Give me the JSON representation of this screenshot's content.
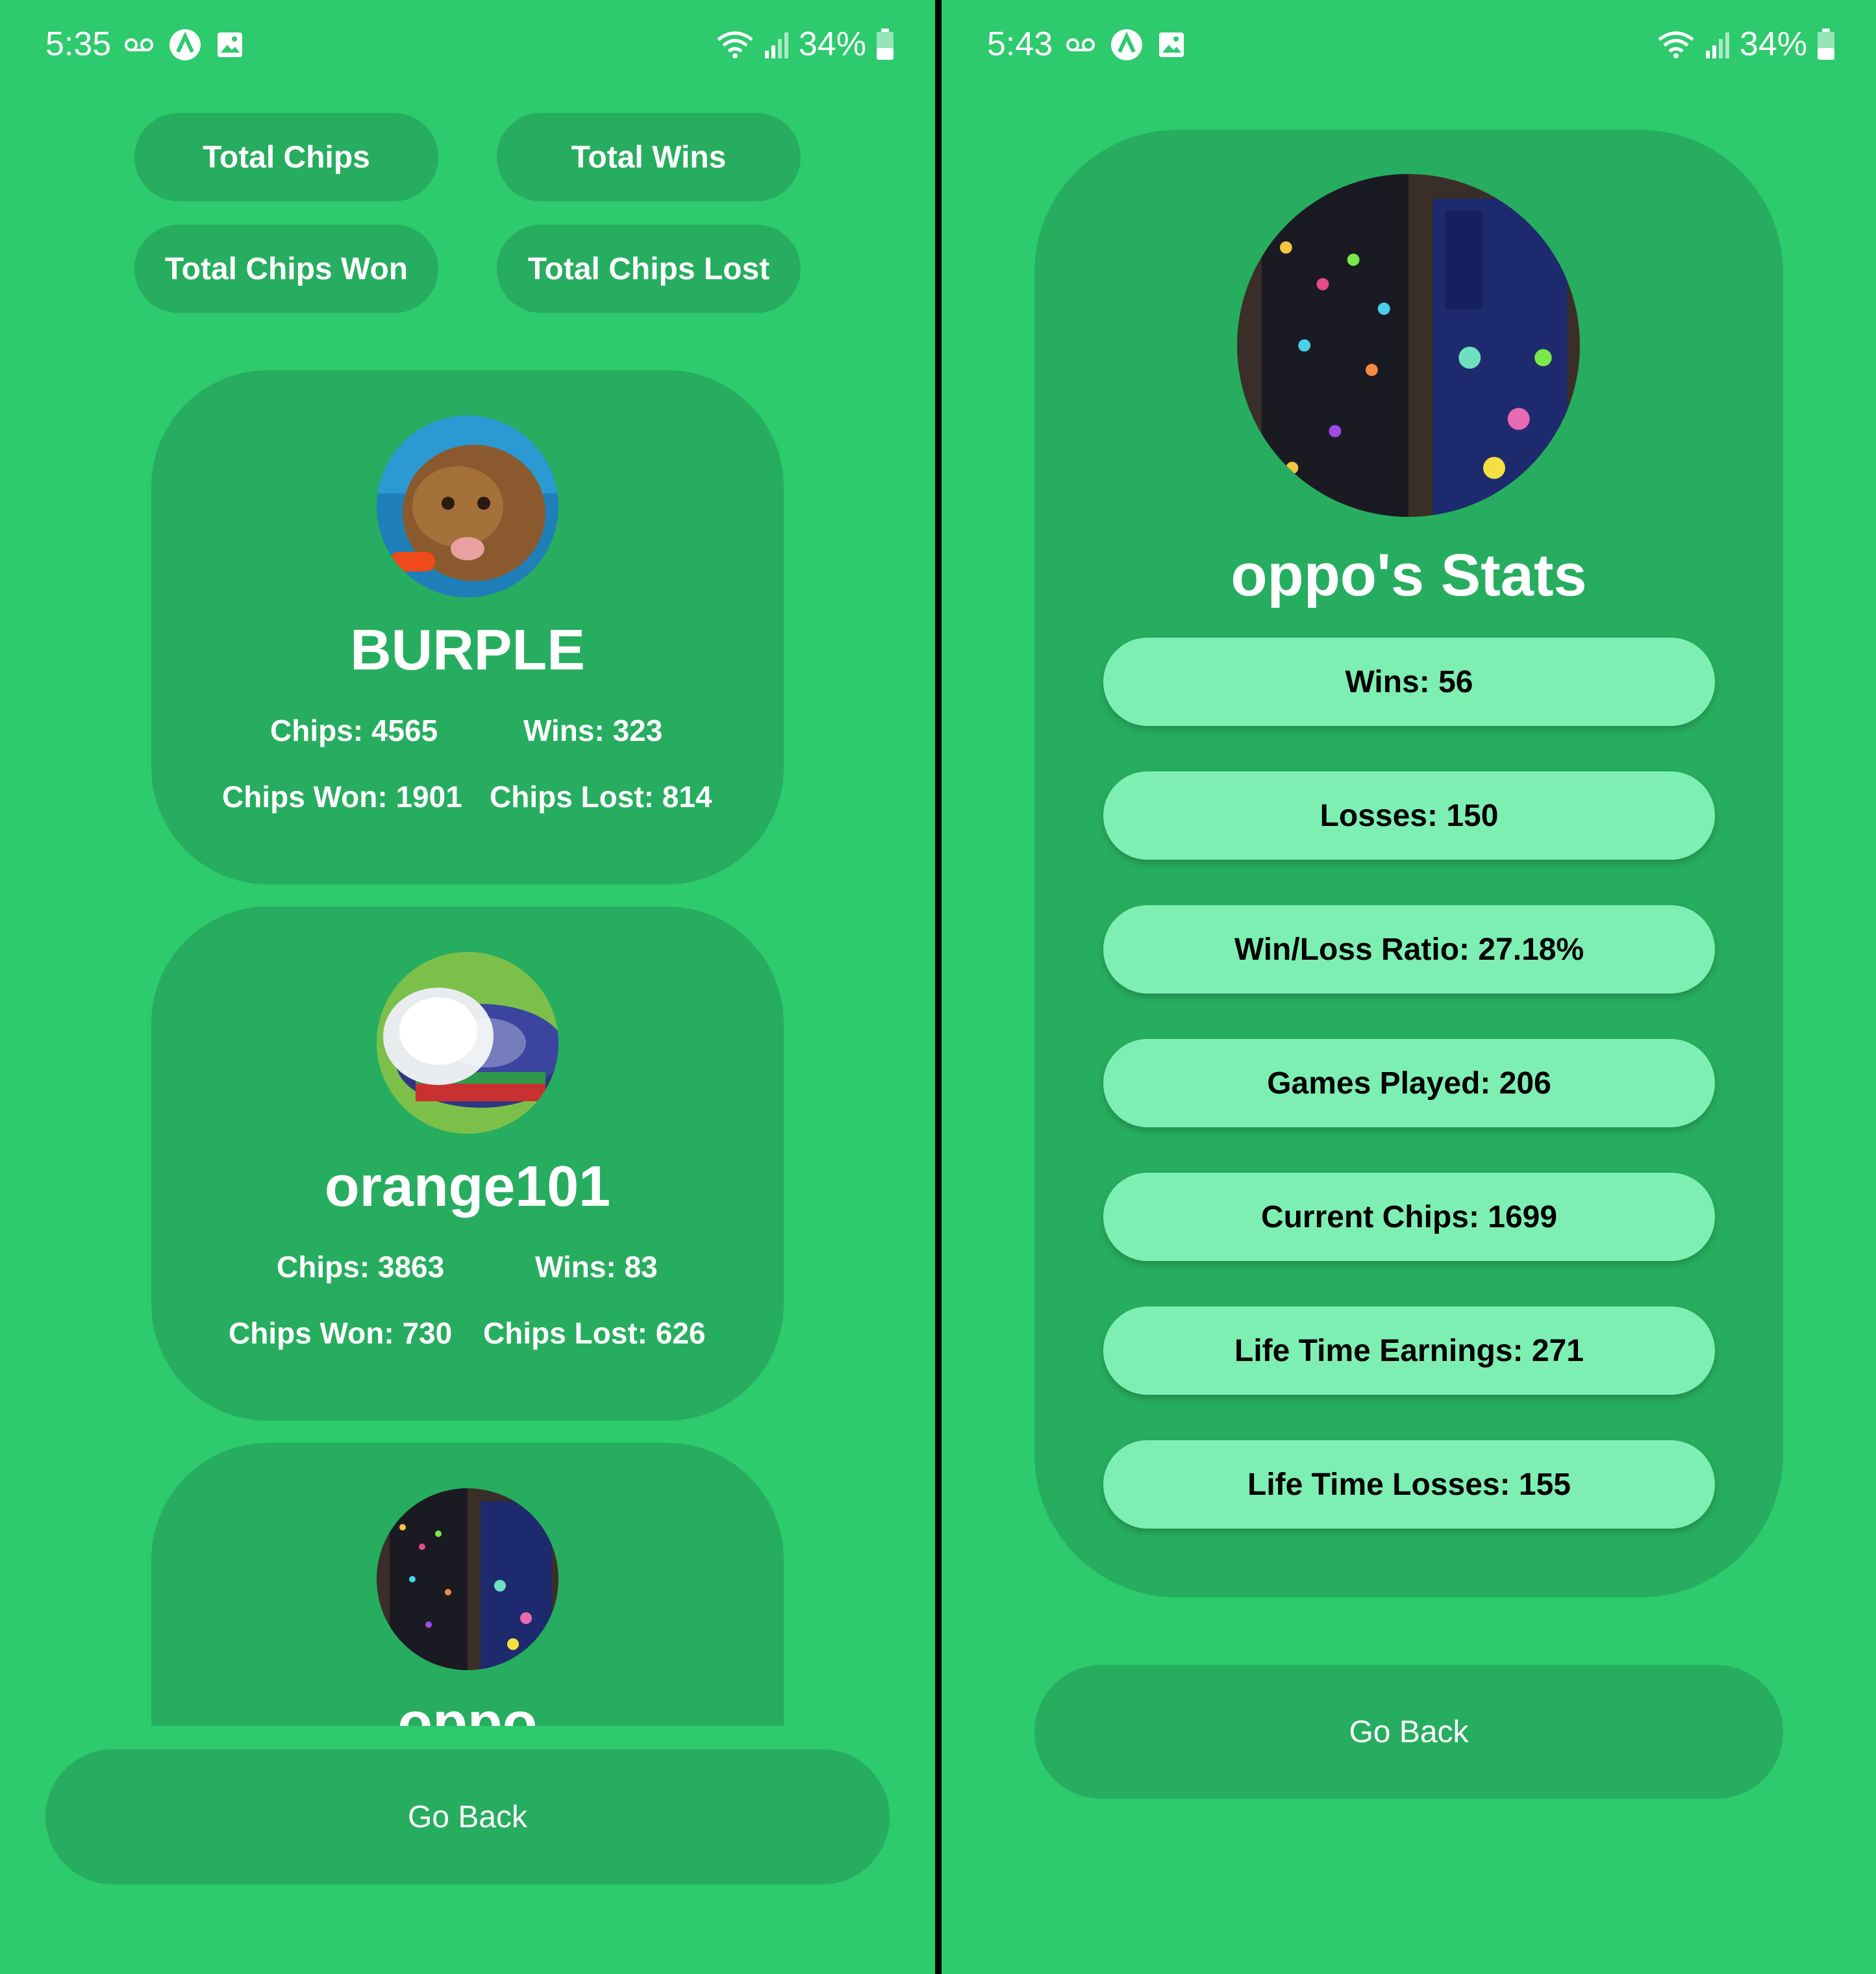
{
  "left": {
    "status_bar": {
      "time": "5:35",
      "battery": "34%"
    },
    "sort_buttons": {
      "total_chips": "Total Chips",
      "total_wins": "Total Wins",
      "total_chips_won": "Total Chips Won",
      "total_chips_lost": "Total Chips Lost"
    },
    "players": [
      {
        "name": "BURPLE",
        "chips": "Chips: 4565",
        "wins": "Wins: 323",
        "chips_won": "Chips Won: 1901",
        "chips_lost": "Chips Lost: 814"
      },
      {
        "name": "orange101",
        "chips": "Chips: 3863",
        "wins": "Wins: 83",
        "chips_won": "Chips Won: 730",
        "chips_lost": "Chips Lost: 626"
      },
      {
        "name": "oppo"
      }
    ],
    "go_back": "Go Back"
  },
  "right": {
    "status_bar": {
      "time": "5:43",
      "battery": "34%"
    },
    "title": "oppo's Stats",
    "stats": [
      "Wins: 56",
      "Losses: 150",
      "Win/Loss Ratio: 27.18%",
      "Games Played: 206",
      "Current Chips:  1699",
      "Life Time Earnings: 271",
      "Life Time Losses: 155"
    ],
    "go_back": "Go Back"
  },
  "colors": {
    "background": "#2dca6e",
    "card": "#27ad5f",
    "stat_pill": "#7eefb2",
    "text": "#ffffff"
  }
}
